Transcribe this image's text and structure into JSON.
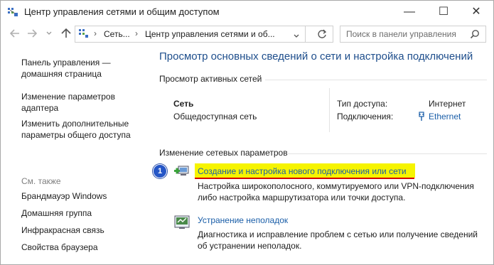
{
  "window": {
    "title": "Центр управления сетями и общим доступом",
    "minimize_glyph": "—",
    "maximize_glyph": "☐",
    "close_glyph": "✕"
  },
  "address_bar": {
    "segments": [
      "Сеть...",
      "Центр управления сетями и об..."
    ],
    "separator": "›",
    "search_placeholder": "Поиск в панели управления"
  },
  "sidebar": {
    "home_link": "Панель управления — домашняя страница",
    "links": [
      "Изменение параметров адаптера",
      "Изменить дополнительные параметры общего доступа"
    ],
    "see_also_label": "См. также",
    "see_also": [
      "Брандмауэр Windows",
      "Домашняя группа",
      "Инфракрасная связь",
      "Свойства браузера"
    ]
  },
  "main": {
    "title": "Просмотр основных сведений о сети и настройка подключений",
    "active_networks_header": "Просмотр активных сетей",
    "network": {
      "name": "Сеть",
      "type": "Общедоступная сеть",
      "access_type_label": "Тип доступа:",
      "access_type_value": "Интернет",
      "connections_label": "Подключения:",
      "connections_value": "Ethernet"
    },
    "change_settings_header": "Изменение сетевых параметров",
    "tasks": [
      {
        "badge": "1",
        "label": "Создание и настройка нового подключения или сети",
        "description": "Настройка широкополосного, коммутируемого или VPN-подключения либо настройка маршрутизатора или точки доступа."
      },
      {
        "label": "Устранение неполадок",
        "description": "Диагностика и исправление проблем с сетью или получение сведений об устранении неполадок."
      }
    ]
  },
  "colors": {
    "title_blue": "#1e4e8c",
    "link_blue": "#1a5ea8",
    "highlight": "#f6f400",
    "underline": "#d40000",
    "badge": "#2556c6"
  }
}
